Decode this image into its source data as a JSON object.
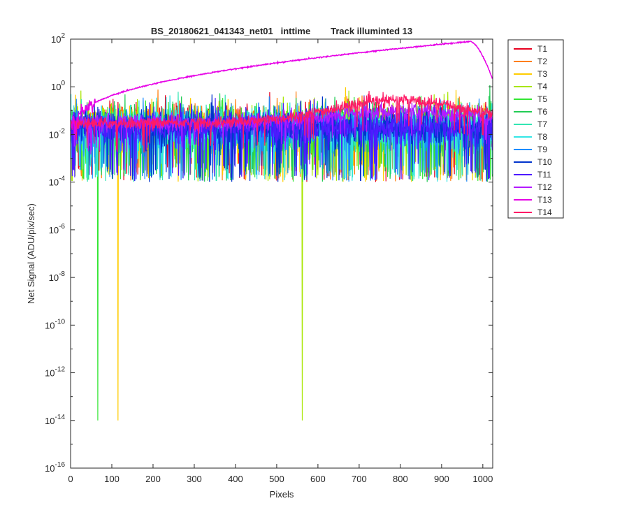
{
  "chart_data": {
    "type": "line",
    "title": "BS_20180621_041343_net01   inttime        Track illuminted 13",
    "xlabel": "Pixels",
    "ylabel": "Net Signal (ADU/pix/sec)",
    "xlim": [
      0,
      1024
    ],
    "ylim": [
      1e-16,
      100
    ],
    "yscale": "log",
    "grid": false,
    "legend_position": "outside-top-right",
    "x_ticks": [
      0,
      100,
      200,
      300,
      400,
      500,
      600,
      700,
      800,
      900,
      1000
    ],
    "y_ticks": [
      {
        "exp": 2,
        "base": "10",
        "power": "2"
      },
      {
        "exp": 0,
        "base": "10",
        "power": "0"
      },
      {
        "exp": -2,
        "base": "10",
        "power": "-2"
      },
      {
        "exp": -4,
        "base": "10",
        "power": "-4"
      },
      {
        "exp": -6,
        "base": "10",
        "power": "-6"
      },
      {
        "exp": -8,
        "base": "10",
        "power": "-8"
      },
      {
        "exp": -10,
        "base": "10",
        "power": "-10"
      },
      {
        "exp": -12,
        "base": "10",
        "power": "-12"
      },
      {
        "exp": -14,
        "base": "10",
        "power": "-14"
      },
      {
        "exp": -16,
        "base": "10",
        "power": "-16"
      }
    ],
    "series": [
      {
        "name": "T1",
        "color": "#e8001f",
        "profile": "noise",
        "base": 0.02,
        "spread": 1.0
      },
      {
        "name": "T2",
        "color": "#ff7f0e",
        "profile": "noise",
        "base": 0.02,
        "spread": 1.0
      },
      {
        "name": "T3",
        "color": "#ffcc00",
        "profile": "noise",
        "base": 0.018,
        "spread": 1.0,
        "dips": [
          {
            "x": 115,
            "y": 1e-14
          }
        ]
      },
      {
        "name": "T4",
        "color": "#a8e600",
        "profile": "noise",
        "base": 0.016,
        "spread": 1.1,
        "dips": [
          {
            "x": 562,
            "y": 1e-14
          }
        ]
      },
      {
        "name": "T5",
        "color": "#33e633",
        "profile": "noise",
        "base": 0.015,
        "spread": 1.1,
        "dips": [
          {
            "x": 66,
            "y": 1e-14
          }
        ]
      },
      {
        "name": "T6",
        "color": "#22cc55",
        "profile": "noise",
        "base": 0.015,
        "spread": 1.1
      },
      {
        "name": "T7",
        "color": "#33e6b3",
        "profile": "noise",
        "base": 0.015,
        "spread": 1.0
      },
      {
        "name": "T8",
        "color": "#33e6e6",
        "profile": "noise",
        "base": 0.016,
        "spread": 1.0
      },
      {
        "name": "T9",
        "color": "#1a8cff",
        "profile": "noise",
        "base": 0.017,
        "spread": 1.0
      },
      {
        "name": "T10",
        "color": "#0033cc",
        "profile": "noise",
        "base": 0.02,
        "spread": 0.8
      },
      {
        "name": "T11",
        "color": "#4d1aff",
        "profile": "noise",
        "base": 0.022,
        "spread": 0.8
      },
      {
        "name": "T12",
        "color": "#b31aff",
        "profile": "track",
        "base": 0.03,
        "peak": 0.1,
        "spread": 0.35
      },
      {
        "name": "T13",
        "color": "#e600e6",
        "profile": "main",
        "start": 0.03,
        "peak": 80,
        "peak_x": 970,
        "end": 2
      },
      {
        "name": "T14",
        "color": "#ff1a66",
        "profile": "track",
        "base": 0.03,
        "peak": 0.28,
        "spread": 0.25
      }
    ]
  }
}
